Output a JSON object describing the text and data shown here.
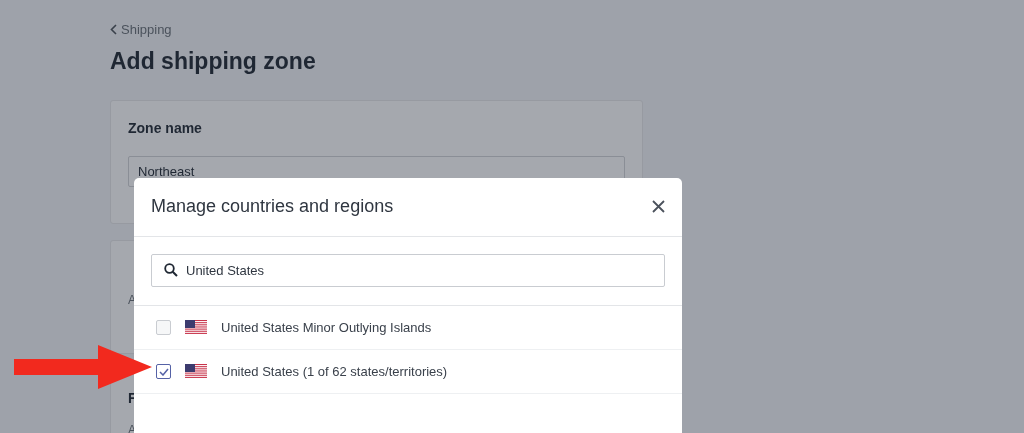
{
  "back_link": "Shipping",
  "title": "Add shipping zone",
  "zone_card": {
    "heading": "Zone name",
    "value": "Northeast"
  },
  "sections": [
    {
      "helper": "A"
    },
    {
      "heading": "F",
      "helper": "A"
    }
  ],
  "modal": {
    "title": "Manage countries and regions",
    "search": {
      "value": "United States"
    },
    "items": [
      {
        "label": "United States Minor Outlying Islands",
        "checked": false
      },
      {
        "label": "United States (1 of 62 states/territories)",
        "checked": true
      }
    ]
  }
}
